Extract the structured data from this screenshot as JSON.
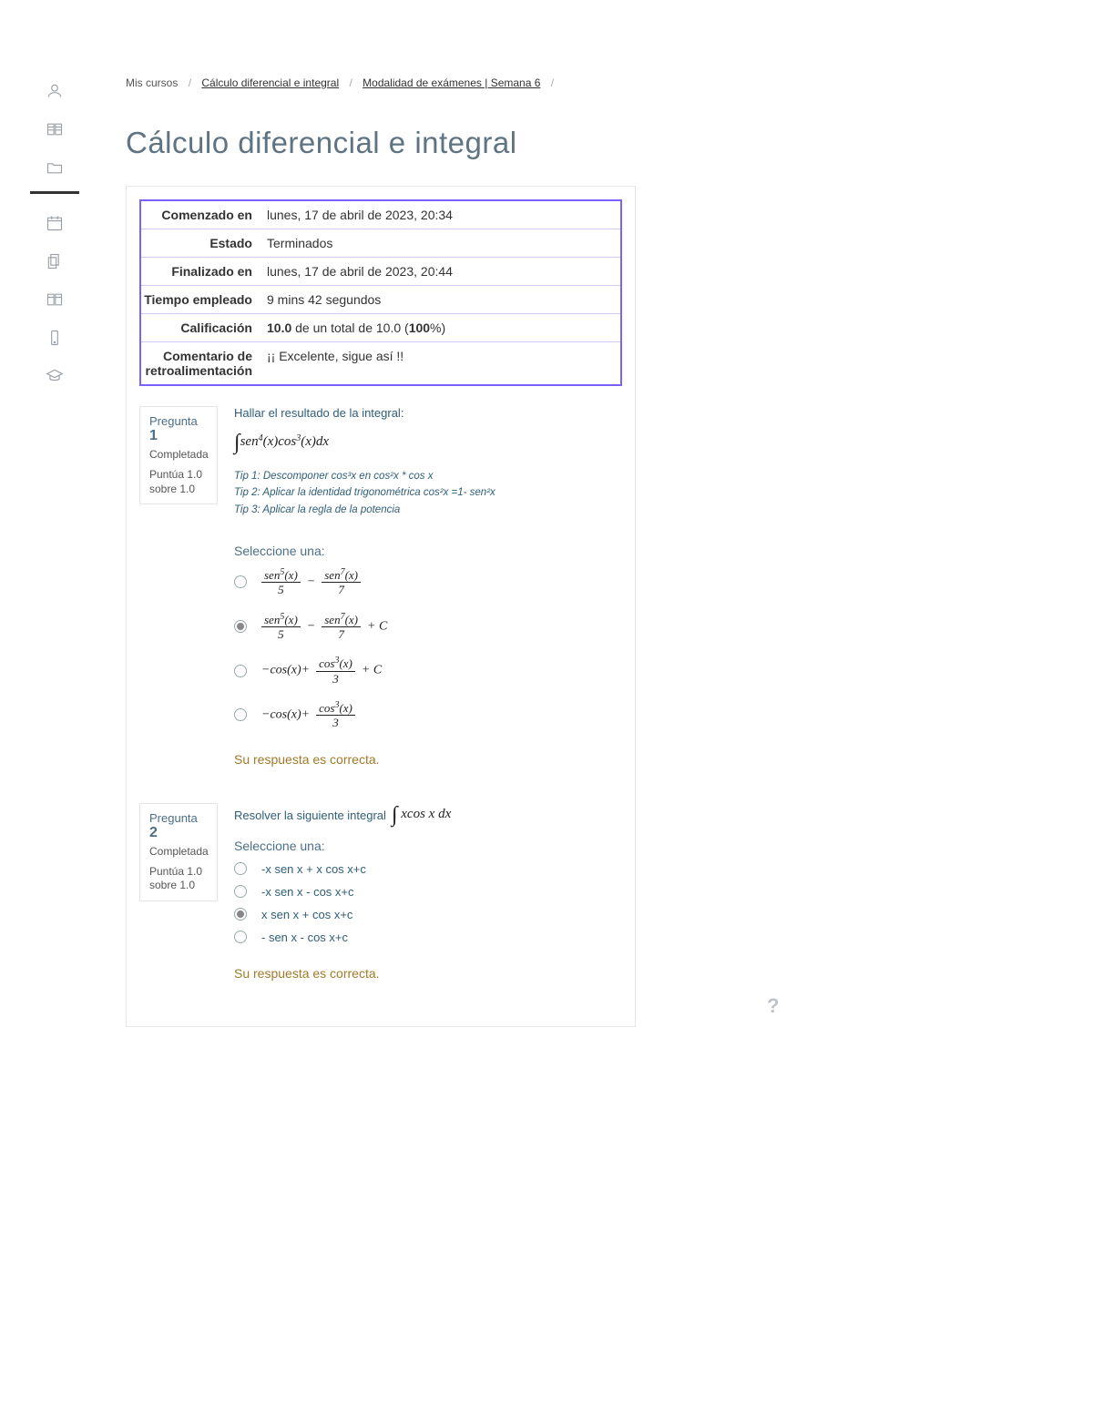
{
  "breadcrumb": {
    "item0": "Mis cursos",
    "item1": "Cálculo diferencial e integral",
    "item2": "Modalidad de exámenes | Semana 6"
  },
  "title": "Cálculo diferencial e integral",
  "summary": {
    "k_started": "Comenzado en",
    "v_started": "lunes, 17 de abril de 2023, 20:34",
    "k_state": "Estado",
    "v_state": "Terminados",
    "k_finished": "Finalizado en",
    "v_finished": "lunes, 17 de abril de 2023, 20:44",
    "k_time": "Tiempo empleado",
    "v_time": "9 mins 42 segundos",
    "k_grade": "Calificación",
    "v_grade_pre": "10.0",
    "v_grade_mid": " de un total de 10.0 (",
    "v_grade_pct": "100",
    "v_grade_post": "%)",
    "k_feedback": "Comentario de retroalimentación",
    "v_feedback": "¡¡ Excelente, sigue así !!"
  },
  "q_label": "Pregunta ",
  "status_complete": "Completada",
  "points_line": "Puntúa 1.0 sobre 1.0",
  "select_one": "Seleccione una:",
  "q1": {
    "num": "1",
    "prompt": "Hallar el resultado de la integral:",
    "integral": "∫ sen⁴(x)cos³(x)dx",
    "tip1": "Tip 1: Descomponer cos³x en cos²x * cos x",
    "tip2": "Tip 2: Aplicar la identidad trigonométrica cos²x =1- sen²x",
    "tip3": "Tip 3: Aplicar la regla de la potencia",
    "options": [
      {
        "text": "sen⁵(x)/5 − sen⁷(x)/7",
        "selected": false
      },
      {
        "text": "sen⁵(x)/5 − sen⁷(x)/7 + C",
        "selected": true
      },
      {
        "text": "−cos(x) + cos³(x)/3 + C",
        "selected": false
      },
      {
        "text": "−cos(x) + cos³(x)/3",
        "selected": false
      }
    ],
    "feedback": "Su respuesta es correcta."
  },
  "q2": {
    "num": "2",
    "prompt": "Resolver la siguiente integral ",
    "integral": "∫ xcos x dx",
    "options": [
      {
        "text": "-x sen x + x cos x+c",
        "selected": false
      },
      {
        "text": "-x sen x - cos x+c",
        "selected": false
      },
      {
        "text": "x sen x + cos x+c",
        "selected": true
      },
      {
        "text": "- sen x - cos x+c",
        "selected": false
      }
    ],
    "feedback": "Su respuesta es correcta."
  },
  "help": "?"
}
